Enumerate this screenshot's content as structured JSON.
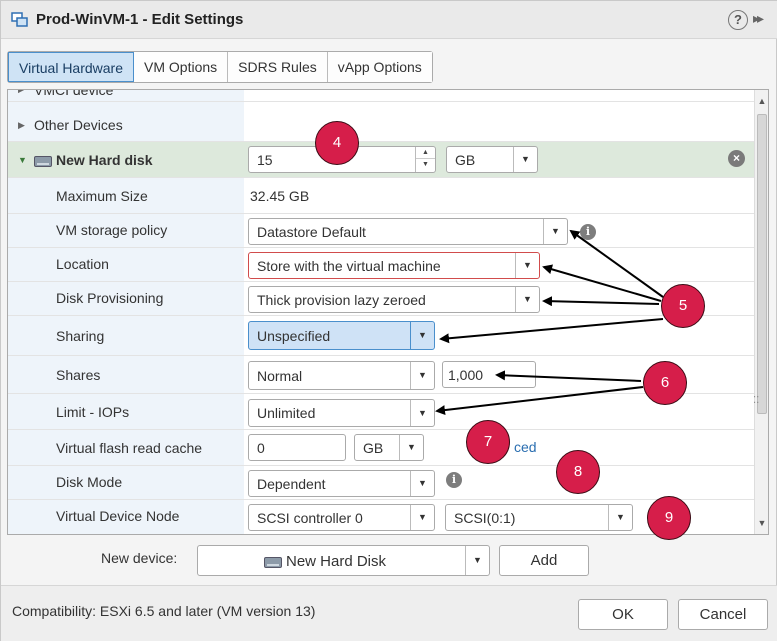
{
  "window": {
    "title": "Prod-WinVM-1 - Edit Settings",
    "help_glyph": "?",
    "expand_glyph": "▸▸"
  },
  "tabs": [
    {
      "label": "Virtual Hardware",
      "active": true
    },
    {
      "label": "VM Options",
      "active": false
    },
    {
      "label": "SDRS Rules",
      "active": false
    },
    {
      "label": "vApp Options",
      "active": false
    }
  ],
  "rows": {
    "vmci_label": "VMCI device",
    "other_devices_label": "Other Devices",
    "new_hard_disk": {
      "label": "New Hard disk",
      "size_value": "15",
      "size_unit": "GB"
    },
    "maximum_size": {
      "label": "Maximum Size",
      "value": "32.45 GB"
    },
    "storage_policy": {
      "label": "VM storage policy",
      "value": "Datastore Default"
    },
    "location": {
      "label": "Location",
      "value": "Store with the virtual machine"
    },
    "disk_provisioning": {
      "label": "Disk Provisioning",
      "value": "Thick provision lazy zeroed"
    },
    "sharing": {
      "label": "Sharing",
      "value": "Unspecified"
    },
    "shares": {
      "label": "Shares",
      "level": "Normal",
      "value": "1,000"
    },
    "limit_iops": {
      "label": "Limit - IOPs",
      "value": "Unlimited"
    },
    "flash_cache": {
      "label": "Virtual flash read cache",
      "value": "0",
      "unit": "GB",
      "link_text": "ced"
    },
    "disk_mode": {
      "label": "Disk Mode",
      "value": "Dependent"
    },
    "device_node": {
      "label": "Virtual Device Node",
      "controller": "SCSI controller 0",
      "node": "SCSI(0:1)"
    }
  },
  "callouts": [
    "4",
    "5",
    "6",
    "7",
    "8",
    "9"
  ],
  "new_device": {
    "label": "New device:",
    "selected": "New Hard Disk",
    "add_label": "Add"
  },
  "footer": {
    "compatibility": "Compatibility: ESXi 6.5 and later (VM version 13)",
    "ok_label": "OK",
    "cancel_label": "Cancel"
  },
  "colors": {
    "callout": "#d61e4a",
    "tab_active": "#cfe3f5",
    "highlight_row": "#dde9dc",
    "error_border": "#d14c4c",
    "link": "#2a6eb0"
  },
  "icons": {
    "title": "vm-settings-icon",
    "disk": "hard-disk-icon",
    "remove": "remove-circle-icon",
    "info": "info-icon"
  }
}
